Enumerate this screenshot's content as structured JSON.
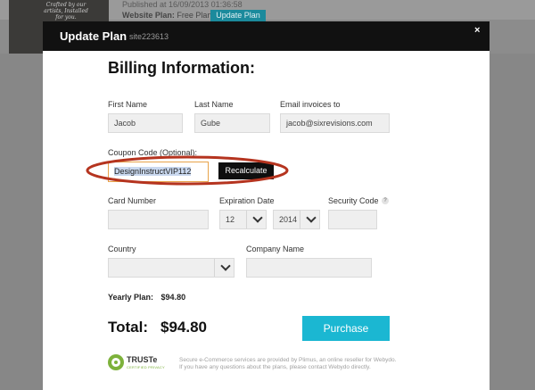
{
  "background": {
    "thumbnail_caption": "Crafted by our artists, Installed for you.",
    "published_text": "Published at 16/09/2013 01:36:58",
    "plan_label": "Website Plan:",
    "plan_value": "Free Plan",
    "update_button": "Update Plan"
  },
  "modal": {
    "title": "Update Plan",
    "site_id": "site223613",
    "close_glyph": "×",
    "heading": "Billing Information:"
  },
  "form": {
    "first_name": {
      "label": "First Name",
      "value": "Jacob"
    },
    "last_name": {
      "label": "Last Name",
      "value": "Gube"
    },
    "email": {
      "label": "Email invoices to",
      "value": "jacob@sixrevisions.com"
    },
    "coupon": {
      "label": "Coupon Code (Optional):",
      "value": "DesignInstructVIP112"
    },
    "recalculate": "Recalculate",
    "card_number": {
      "label": "Card Number",
      "value": ""
    },
    "expiration": {
      "label": "Expiration Date",
      "month": "12",
      "year": "2014"
    },
    "security_code": {
      "label": "Security Code",
      "help": "?",
      "value": ""
    },
    "country": {
      "label": "Country",
      "value": ""
    },
    "company": {
      "label": "Company Name",
      "value": ""
    }
  },
  "summary": {
    "yearly_label": "Yearly Plan:",
    "yearly_value": "$94.80",
    "total_label": "Total:",
    "total_value": "$94.80",
    "purchase_button": "Purchase"
  },
  "footer": {
    "truste_name": "TRUSTe",
    "truste_sub": "CERTIFIED PRIVACY",
    "secure_line1": "Secure e-Commerce services are provided by Plimus, an online reseller for Webydo.",
    "secure_line2": "If you have any questions about the plans, please contact Webydo directly."
  },
  "colors": {
    "accent": "#1bb7d2",
    "header": "#111111",
    "annotation_ring": "#b5341f"
  },
  "icons": {
    "close": "close-icon",
    "chevron": "chevron-down-icon",
    "help": "help-icon",
    "seal": "truste-seal-icon"
  }
}
